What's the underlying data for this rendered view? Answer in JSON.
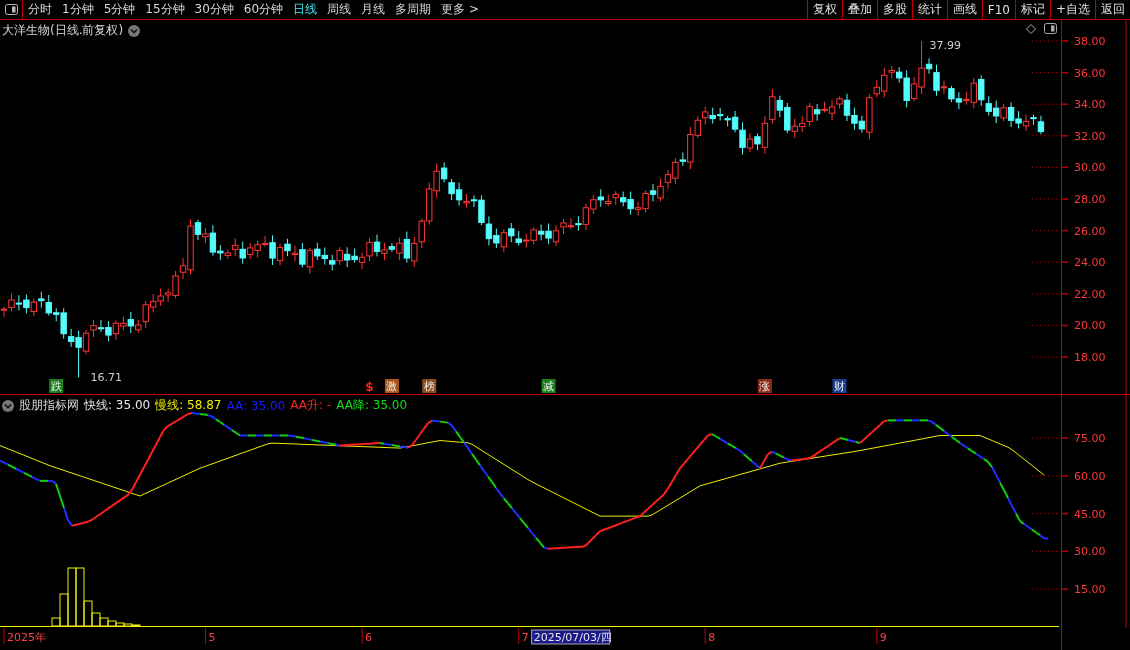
{
  "toolbar": {
    "periods": [
      {
        "label": "分时",
        "selected": false
      },
      {
        "label": "1分钟",
        "selected": false
      },
      {
        "label": "5分钟",
        "selected": false
      },
      {
        "label": "15分钟",
        "selected": false
      },
      {
        "label": "30分钟",
        "selected": false
      },
      {
        "label": "60分钟",
        "selected": false
      },
      {
        "label": "日线",
        "selected": true
      },
      {
        "label": "周线",
        "selected": false
      },
      {
        "label": "月线",
        "selected": false
      },
      {
        "label": "多周期",
        "selected": false
      },
      {
        "label": "更多 >",
        "selected": false
      }
    ],
    "actions": [
      "复权",
      "叠加",
      "多股",
      "统计",
      "画线",
      "F10",
      "标记",
      "+自选",
      "返回"
    ]
  },
  "stock_title": "大洋生物(日线.前复权)",
  "price_chart": {
    "ticks": [
      "38.00",
      "36.00",
      "34.00",
      "32.00",
      "30.00",
      "28.00",
      "26.00",
      "24.00",
      "22.00",
      "20.00",
      "18.00"
    ],
    "high_label": {
      "text": "37.99"
    },
    "low_label": {
      "text": "16.71"
    },
    "signals": [
      {
        "text": "跌",
        "kind": "box",
        "color": "#1b7f1b"
      },
      {
        "text": "$",
        "kind": "mark",
        "color": "#ff2020"
      },
      {
        "text": "激",
        "kind": "box",
        "color": "#a8561c"
      },
      {
        "text": "榜",
        "kind": "box",
        "color": "#8c4a16"
      },
      {
        "text": "减",
        "kind": "box",
        "color": "#1b7f1b"
      },
      {
        "text": "涨",
        "kind": "box",
        "color": "#8c2a18"
      },
      {
        "text": "财",
        "kind": "box",
        "color": "#1e3f8f"
      }
    ]
  },
  "indicator": {
    "name": "股朋指标网",
    "legend": [
      {
        "text": "快线: 35.00",
        "color": "#e6e6e6"
      },
      {
        "text": "慢线: 58.87",
        "color": "#f0f000"
      },
      {
        "text": "AA: 35.00",
        "color": "#1a1aff"
      },
      {
        "text": "AA升: -",
        "color": "#ff2020"
      },
      {
        "text": "AA降: 35.00",
        "color": "#10e010"
      }
    ],
    "ticks": [
      "75.00",
      "60.00",
      "45.00",
      "30.00",
      "15.00"
    ]
  },
  "date_axis": [
    {
      "text": "2025年",
      "selected": false
    },
    {
      "text": "5",
      "selected": false
    },
    {
      "text": "6",
      "selected": false
    },
    {
      "text": "7",
      "selected": false
    },
    {
      "text": "2025/07/03/四",
      "selected": true
    },
    {
      "text": "8",
      "selected": false
    },
    {
      "text": "9",
      "selected": false
    }
  ]
}
